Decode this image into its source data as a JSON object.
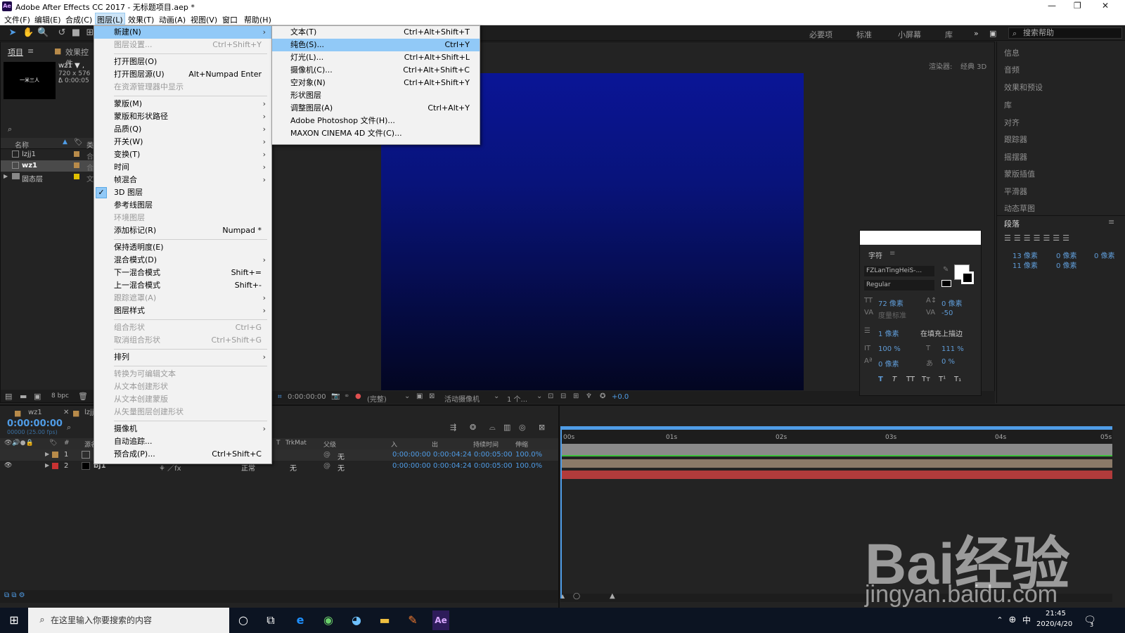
{
  "window": {
    "title": "Adobe After Effects CC 2017 - 无标题项目.aep *",
    "logo": "Ae"
  },
  "menubar": [
    "文件(F)",
    "编辑(E)",
    "合成(C)",
    "图层(L)",
    "效果(T)",
    "动画(A)",
    "视图(V)",
    "窗口",
    "帮助(H)"
  ],
  "toolbar": {
    "workspaces": [
      "必要项",
      "标准",
      "小屏幕",
      "库"
    ],
    "help_search_placeholder": "搜索帮助"
  },
  "project": {
    "tabs": [
      "项目",
      "效果控件"
    ],
    "comp_name": "wz1 ▼ ,",
    "comp_info": "720 x 576 (",
    "comp_duration": "Δ 0:00:05",
    "thumb_text": "一米三人",
    "col_name": "名称",
    "col_type": "类",
    "items": [
      {
        "name": "lzjj1",
        "color": "#b88b4a",
        "type": "合"
      },
      {
        "name": "wz1",
        "color": "#b88b4a",
        "type": "合"
      },
      {
        "name": "固态层",
        "color": "#e0c000",
        "type": "文"
      }
    ],
    "bpc": "8 bpc"
  },
  "viewer": {
    "renderer_label": "渲染器:",
    "renderer_value": "经典 3D",
    "timecode": "0:00:00:00",
    "resolution": "(完整)",
    "camera": "活动摄像机",
    "views": "1 个...",
    "exposure": "+0.0"
  },
  "right_panel": {
    "items": [
      "信息",
      "音频",
      "效果和预设",
      "库",
      "对齐",
      "跟踪器",
      "摇摆器",
      "蒙版插值",
      "平滑器",
      "动态草图"
    ],
    "paragraph_title": "段落",
    "para_values": [
      "13 像素",
      "0 像素",
      "0 像素",
      "11 像素",
      "0 像素"
    ]
  },
  "character": {
    "title": "字符",
    "font": "FZLanTingHeiS-...",
    "style": "Regular",
    "size": "72 像素",
    "leading": "0 像素",
    "kerning": "度量标准",
    "tracking": "-50",
    "stroke": "1 像素",
    "stroke_mode": "在填充上描边",
    "vscale": "100 %",
    "hscale": "111 %",
    "baseline": "0 像素",
    "tsume": "0 %",
    "styles": [
      "T",
      "T",
      "TT",
      "Tт",
      "T¹",
      "T₁"
    ]
  },
  "layer_menu": {
    "items": [
      {
        "label": "新建(N)",
        "shortcut": "",
        "submenu": true,
        "highlight": true
      },
      {
        "label": "图层设置...",
        "shortcut": "Ctrl+Shift+Y",
        "disabled": true
      },
      {
        "sep": true
      },
      {
        "label": "打开图层(O)",
        "shortcut": ""
      },
      {
        "label": "打开图层源(U)",
        "shortcut": "Alt+Numpad Enter"
      },
      {
        "label": "在资源管理器中显示",
        "shortcut": "",
        "disabled": true
      },
      {
        "sep": true
      },
      {
        "label": "蒙版(M)",
        "submenu": true
      },
      {
        "label": "蒙版和形状路径",
        "submenu": true
      },
      {
        "label": "品质(Q)",
        "submenu": true
      },
      {
        "label": "开关(W)",
        "submenu": true
      },
      {
        "label": "变换(T)",
        "submenu": true
      },
      {
        "label": "时间",
        "submenu": true
      },
      {
        "label": "帧混合",
        "submenu": true
      },
      {
        "label": "3D 图层",
        "checked": true
      },
      {
        "label": "参考线图层"
      },
      {
        "label": "环境图层",
        "disabled": true
      },
      {
        "label": "添加标记(R)",
        "shortcut": "Numpad *"
      },
      {
        "sep": true
      },
      {
        "label": "保持透明度(E)"
      },
      {
        "label": "混合模式(D)",
        "submenu": true
      },
      {
        "label": "下一混合模式",
        "shortcut": "Shift+="
      },
      {
        "label": "上一混合模式",
        "shortcut": "Shift+-"
      },
      {
        "label": "跟踪遮罩(A)",
        "submenu": true,
        "disabled": true
      },
      {
        "label": "图层样式",
        "submenu": true
      },
      {
        "sep": true
      },
      {
        "label": "组合形状",
        "shortcut": "Ctrl+G",
        "disabled": true
      },
      {
        "label": "取消组合形状",
        "shortcut": "Ctrl+Shift+G",
        "disabled": true
      },
      {
        "sep": true
      },
      {
        "label": "排列",
        "submenu": true
      },
      {
        "sep": true
      },
      {
        "label": "转换为可编辑文本",
        "disabled": true
      },
      {
        "label": "从文本创建形状",
        "disabled": true
      },
      {
        "label": "从文本创建蒙版",
        "disabled": true
      },
      {
        "label": "从矢量图层创建形状",
        "disabled": true
      },
      {
        "sep": true
      },
      {
        "label": "摄像机",
        "submenu": true
      },
      {
        "label": "自动追踪..."
      },
      {
        "label": "预合成(P)...",
        "shortcut": "Ctrl+Shift+C"
      }
    ]
  },
  "new_submenu": {
    "items": [
      {
        "label": "文本(T)",
        "shortcut": "Ctrl+Alt+Shift+T"
      },
      {
        "label": "纯色(S)...",
        "shortcut": "Ctrl+Y",
        "highlight": true
      },
      {
        "label": "灯光(L)...",
        "shortcut": "Ctrl+Alt+Shift+L"
      },
      {
        "label": "摄像机(C)...",
        "shortcut": "Ctrl+Alt+Shift+C"
      },
      {
        "label": "空对象(N)",
        "shortcut": "Ctrl+Alt+Shift+Y"
      },
      {
        "label": "形状图层",
        "shortcut": ""
      },
      {
        "label": "调整图层(A)",
        "shortcut": "Ctrl+Alt+Y"
      },
      {
        "label": "Adobe Photoshop 文件(H)...",
        "shortcut": ""
      },
      {
        "label": "MAXON CINEMA 4D 文件(C)...",
        "shortcut": ""
      }
    ]
  },
  "timeline": {
    "tabs": [
      "wz1",
      "lzjj1"
    ],
    "timecode": "0:00:00:00",
    "fps": "00000 (25.00 fps)",
    "columns": [
      "#",
      "源名",
      "T",
      "TrkMat",
      "父级",
      "入",
      "出",
      "持续时间",
      "伸缩"
    ],
    "ruler": [
      "00s",
      "01s",
      "02s",
      "03s",
      "04s",
      "05s"
    ],
    "layers": [
      {
        "num": "1",
        "name": "",
        "mode": "",
        "trkmat": "",
        "parent": "无",
        "in": "0:00:00:00",
        "out": "0:00:04:24",
        "dur": "0:00:05:00",
        "stretch": "100.0%",
        "color": "#b88b4a"
      },
      {
        "num": "2",
        "name": "bj1",
        "mode": "正常",
        "trkmat": "无",
        "parent": "无",
        "in": "0:00:00:00",
        "out": "0:00:04:24",
        "dur": "0:00:05:00",
        "stretch": "100.0%",
        "color": "#c83232"
      }
    ]
  },
  "taskbar": {
    "search_placeholder": "在这里输入你要搜索的内容",
    "time": "21:45",
    "date": "2020/4/20",
    "ime": "中",
    "notifications": "3"
  },
  "watermark": {
    "brand": "Bai经验",
    "url": "jingyan.baidu.com"
  },
  "colors": {
    "highlight": "#91c9f7",
    "timecode_blue": "#4f9ce6",
    "bar_layer1": "#8b7a68",
    "bar_layer2": "#b13b3b"
  }
}
